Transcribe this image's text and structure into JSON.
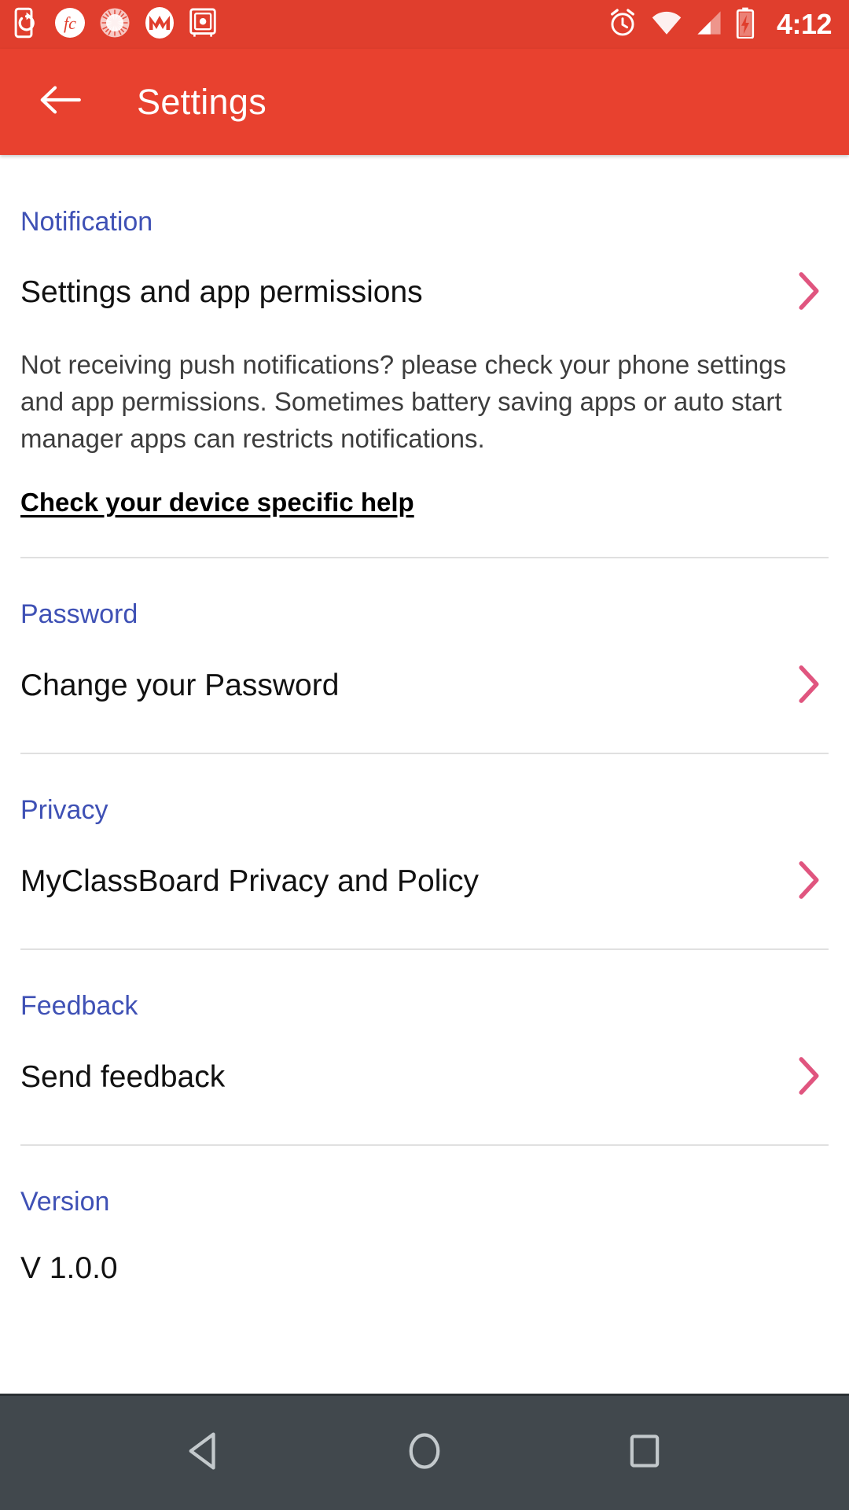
{
  "status_bar": {
    "left_icons": [
      {
        "name": "phone-sync-icon"
      },
      {
        "name": "fc-circle-icon",
        "label": "fc"
      },
      {
        "name": "sunburst-circle-icon"
      },
      {
        "name": "motorola-logo-icon"
      },
      {
        "name": "safe-vault-icon"
      }
    ],
    "right_icons": [
      {
        "name": "alarm-clock-icon"
      },
      {
        "name": "wifi-icon"
      },
      {
        "name": "cellular-signal-icon"
      },
      {
        "name": "battery-charging-icon"
      }
    ],
    "time": "4:12",
    "background_color": "#E03E2D"
  },
  "app_bar": {
    "back_icon": "arrow-left-icon",
    "title": "Settings",
    "background_color": "#E8412F",
    "text_color": "#FFFFFF"
  },
  "colors": {
    "section_header": "#3F51B5",
    "chevron": "#E0557F",
    "divider": "#E0E0E0",
    "body_text": "#3D3D3D",
    "item_text": "#111111"
  },
  "sections": [
    {
      "header": "Notification",
      "item_label": "Settings and app permissions",
      "chevron_icon": "chevron-right-icon",
      "paragraph": "Not receiving push notifications? please check your phone settings and app permissions. Sometimes battery saving apps or auto start manager apps can restricts notifications.",
      "link_label": "Check your device specific help"
    },
    {
      "header": "Password",
      "item_label": "Change your Password",
      "chevron_icon": "chevron-right-icon"
    },
    {
      "header": "Privacy",
      "item_label": "MyClassBoard Privacy and Policy",
      "chevron_icon": "chevron-right-icon"
    },
    {
      "header": "Feedback",
      "item_label": "Send feedback",
      "chevron_icon": "chevron-right-icon"
    },
    {
      "header": "Version",
      "value": "V 1.0.0"
    }
  ],
  "nav_bar": {
    "back": "nav-back-icon",
    "home": "nav-home-icon",
    "recents": "nav-recents-icon",
    "background_color": "#41484D"
  }
}
